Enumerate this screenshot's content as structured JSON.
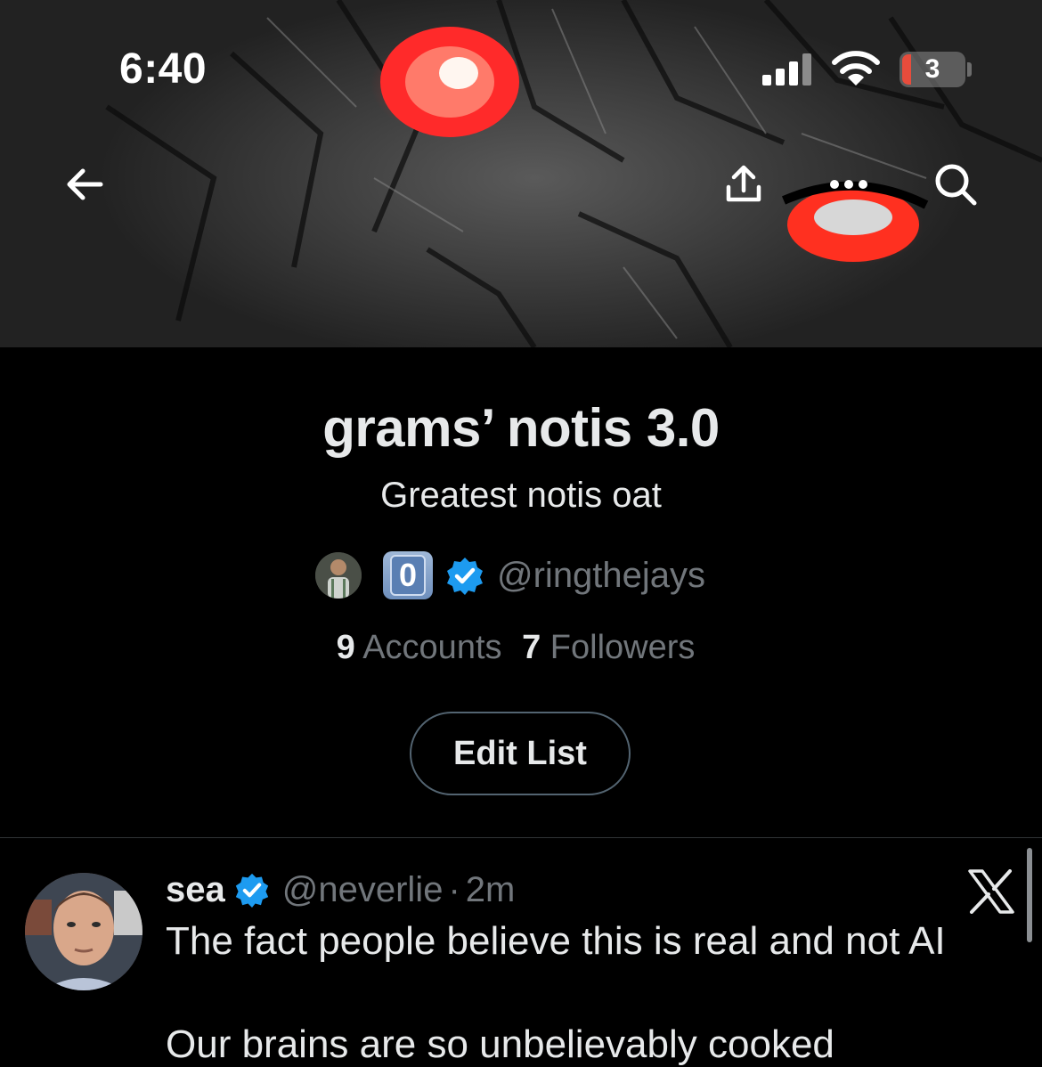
{
  "status_bar": {
    "time": "6:40",
    "battery": "3"
  },
  "list": {
    "title": "grams’ notis 3.0",
    "description": "Greatest notis oat",
    "owner_emoji": "0",
    "owner_handle": "@ringthejays",
    "accounts_count": "9",
    "accounts_label": "Accounts",
    "followers_count": "7",
    "followers_label": "Followers",
    "edit_button": "Edit List"
  },
  "tweet": {
    "name": "sea",
    "handle": "@neverlie",
    "separator": "·",
    "time": "2m",
    "text_line_1": "The fact people believe this is real and not AI",
    "text_line_2": "Our brains are so unbelievably cooked"
  },
  "icons": {
    "back": "arrow-left-icon",
    "share": "share-icon",
    "more": "more-horizontal-icon",
    "search": "search-icon",
    "verified": "verified-badge-icon",
    "x_logo": "x-logo-icon"
  },
  "colors": {
    "accent": "#1d9bf0",
    "background": "#000000",
    "text": "#e7e9ea",
    "muted": "#71767b",
    "eye_red": "#ff2a2a"
  }
}
